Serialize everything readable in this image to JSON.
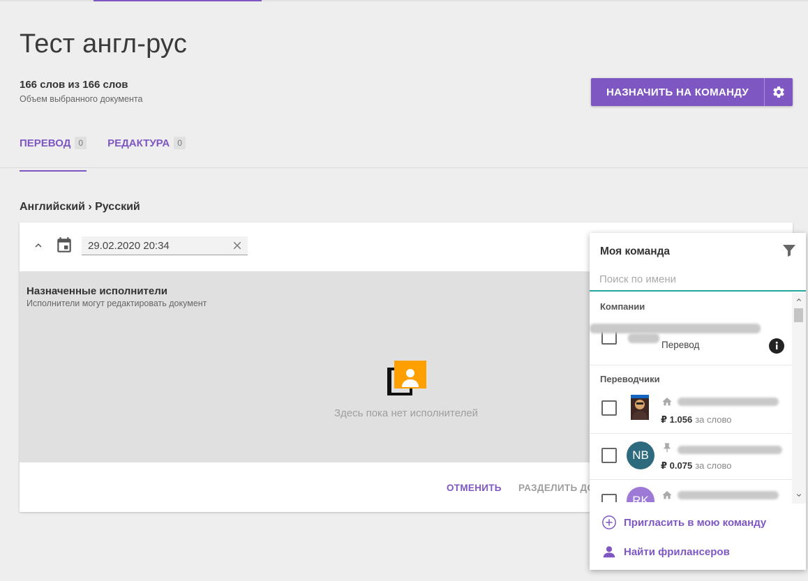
{
  "document": {
    "title": "Тест англ-рус",
    "word_count": "166 слов из 166 слов",
    "word_count_sub": "Объем выбранного документа"
  },
  "assign_button": {
    "label": "НАЗНАЧИТЬ НА КОМАНДУ"
  },
  "tabs": [
    {
      "label": "ПЕРЕВОД",
      "count": "0",
      "active": true
    },
    {
      "label": "РЕДАКТУРА",
      "count": "0",
      "active": false
    }
  ],
  "language_pair": "Английский › Русский",
  "deadline": {
    "value": "29.02.2020 20:34"
  },
  "assignees": {
    "title": "Назначенные исполнители",
    "subtitle": "Исполнители могут редактировать документ",
    "empty_text": "Здесь пока нет исполнителей"
  },
  "footer": {
    "cancel_label": "ОТМЕНИТЬ",
    "split_label": "РАЗДЕЛИТЬ ДО"
  },
  "team_panel": {
    "title": "Моя команда",
    "search_placeholder": "Поиск по имени",
    "companies_label": "Компании",
    "company": {
      "role": "Перевод"
    },
    "translators_label": "Переводчики",
    "translators": [
      {
        "initials": "",
        "price": "₽ 1.056",
        "unit": "за слово",
        "avatar_color": "#8d6e63"
      },
      {
        "initials": "NB",
        "price": "₽ 0.075",
        "unit": "за слово",
        "avatar_color": "#2e6a7d"
      },
      {
        "initials": "RK",
        "price": "",
        "unit": "",
        "avatar_color": "#9c7ad6"
      }
    ],
    "invite_label": "Пригласить в мою команду",
    "find_label": "Найти фрилансеров"
  },
  "colors": {
    "accent": "#7e57c2",
    "teal": "#26a69a",
    "orange": "#ffa000"
  }
}
